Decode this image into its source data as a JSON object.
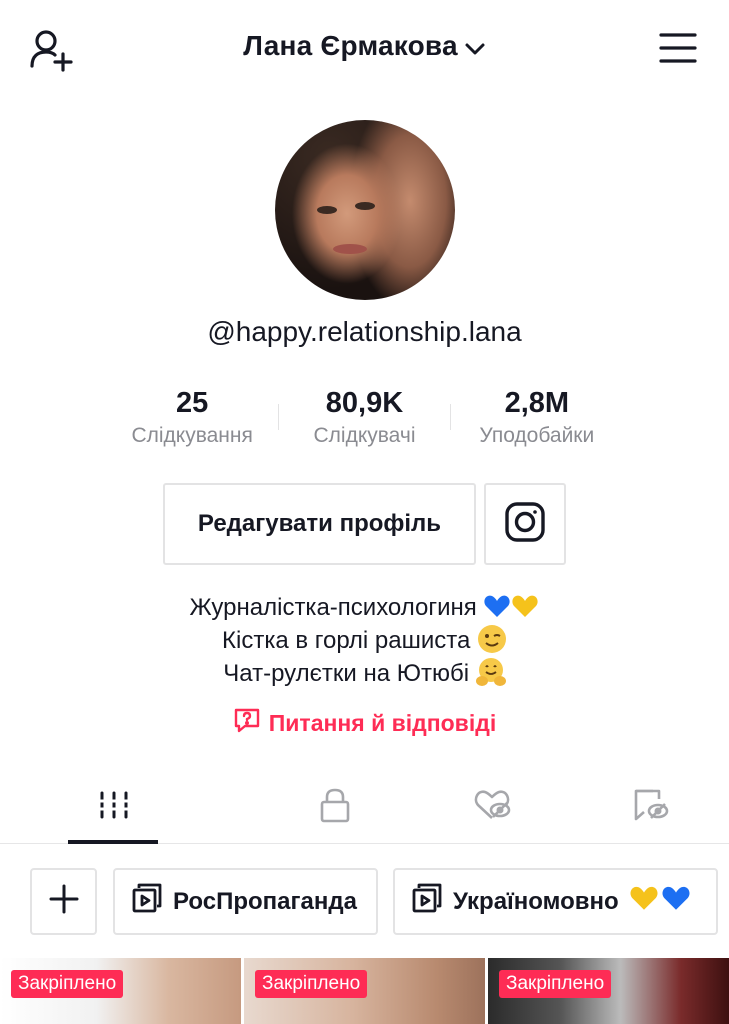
{
  "header": {
    "title": "Лана Єрмакова",
    "add_user_icon": "add-user-icon",
    "chevron_icon": "chevron-down-icon",
    "menu_icon": "hamburger-menu-icon"
  },
  "profile": {
    "handle": "@happy.relationship.lana",
    "stats": [
      {
        "value": "25",
        "label": "Слідкування"
      },
      {
        "value": "80,9K",
        "label": "Слідкувачі"
      },
      {
        "value": "2,8M",
        "label": "Уподобайки"
      }
    ],
    "edit_button": "Редагувати профіль",
    "instagram_icon": "instagram-icon",
    "bio_lines": [
      "Журналістка-психологиня",
      "Кістка в горлі рашиста",
      "Чат-рулєтки на Ютюбі"
    ],
    "qa_label": "Питання й відповіді"
  },
  "tabs": [
    {
      "icon": "videos-grid-icon",
      "active": true
    },
    {
      "icon": "lock-icon",
      "active": false
    },
    {
      "icon": "liked-hidden-icon",
      "active": false
    },
    {
      "icon": "saved-hidden-icon",
      "active": false
    }
  ],
  "playlists": [
    {
      "label": "РосПропаганда"
    },
    {
      "label": "Україномовно"
    }
  ],
  "videos": [
    {
      "badge": "Закріплено"
    },
    {
      "badge": "Закріплено"
    },
    {
      "badge": "Закріплено"
    }
  ],
  "colors": {
    "accent": "#fe2c55",
    "text": "#161823",
    "muted": "#8a8b91",
    "border": "#e3e3e4"
  }
}
